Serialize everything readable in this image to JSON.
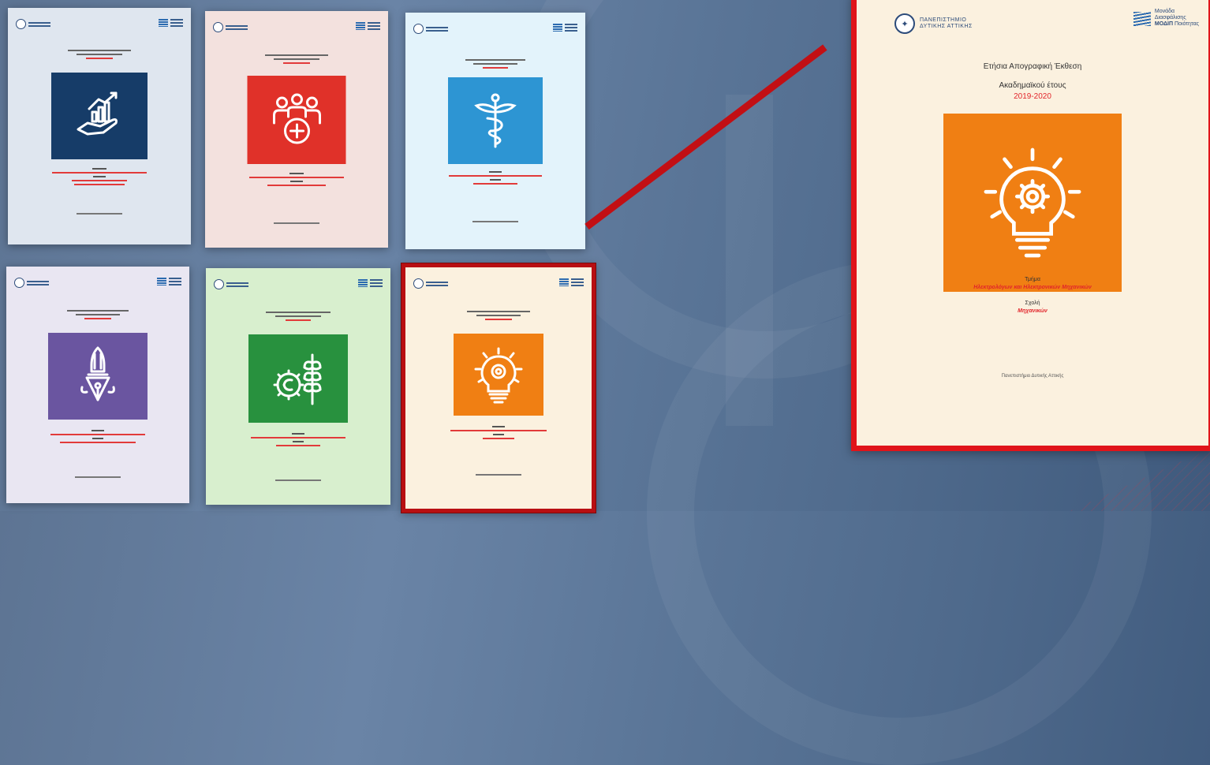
{
  "palette": {
    "background": "#5d7493",
    "highlight_frame": "#e0141a",
    "orange": "#f07f13",
    "red_text": "#e2252b"
  },
  "covers": [
    {
      "id": "cover-1",
      "page_bg": "#dfe6ef",
      "icon_bg": "#163c68",
      "icon": "hand-growth-chart-icon"
    },
    {
      "id": "cover-2",
      "page_bg": "#f3e1de",
      "icon_bg": "#e03129",
      "icon": "group-medical-plus-icon"
    },
    {
      "id": "cover-3",
      "page_bg": "#e3f3fb",
      "icon_bg": "#2d95d3",
      "icon": "caduceus-icon"
    },
    {
      "id": "cover-4",
      "page_bg": "#e9e6f2",
      "icon_bg": "#6a55a0",
      "icon": "pen-nib-icon"
    },
    {
      "id": "cover-5",
      "page_bg": "#d8efce",
      "icon_bg": "#28913e",
      "icon": "gear-wheat-icon"
    },
    {
      "id": "cover-6",
      "page_bg": "#fbf1df",
      "icon_bg": "#f07f13",
      "icon": "lightbulb-gear-icon"
    }
  ],
  "big_cover": {
    "university_line1": "ΠΑΝΕΠΙΣΤΗΜΙΟ",
    "university_line2": "ΔΥΤΙΚΗΣ ΑΤΤΙΚΗΣ",
    "unit_line1": "Μονάδα",
    "unit_line2": "Διασφάλισης",
    "unit_line3": "Ποιότητας",
    "unit_abbr": "ΜΟΔΙΠ",
    "report_title": "Ετήσια Απογραφική Έκθεση",
    "year_label": "Ακαδημαϊκού έτους",
    "year_value": "2019-2020",
    "dept_label": "Τμήμα",
    "dept_value": "Ηλεκτρολόγων και Ηλεκτρονικών Μηχανικών",
    "school_label": "Σχολή",
    "school_value": "Μηχανικών",
    "footer": "Πανεπιστήμιο Δυτικής Αττικής",
    "icon": "lightbulb-gear-icon"
  }
}
